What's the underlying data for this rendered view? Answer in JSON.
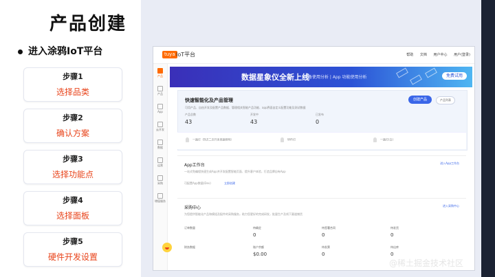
{
  "slide": {
    "title": "产品创建",
    "bullet": "进入涂鸦IoT平台",
    "steps": [
      {
        "label": "步骤1",
        "action": "选择品类"
      },
      {
        "label": "步骤2",
        "action": "确认方案"
      },
      {
        "label": "步骤3",
        "action": "选择功能点"
      },
      {
        "label": "步骤4",
        "action": "选择面板"
      },
      {
        "label": "步骤5",
        "action": "硬件开发设置"
      }
    ],
    "watermark": "@稀土掘金技术社区"
  },
  "colors": {
    "accent": "#e8431a",
    "brand": "#ff6a00",
    "primary": "#3a66e8"
  },
  "screenshot": {
    "logo": "tuya",
    "brand": "IoT平台",
    "top_nav": [
      "帮助",
      "文档",
      "用户中心",
      "用户(登录)"
    ],
    "sidebar": [
      {
        "label": "产品",
        "icon": "home-icon"
      },
      {
        "label": "产品",
        "icon": "product-icon"
      },
      {
        "label": "App",
        "icon": "app-icon"
      },
      {
        "label": "云开发",
        "icon": "cloud-icon"
      },
      {
        "label": "数据",
        "icon": "data-icon"
      },
      {
        "label": "运营",
        "icon": "ops-icon"
      },
      {
        "label": "采购",
        "icon": "purchase-icon"
      },
      {
        "label": "增值服务",
        "icon": "service-icon"
      }
    ],
    "banner": {
      "title": "数据星象仪全新上线",
      "subtitle": "设备使用分析 | App 功能使用分析",
      "button": "免费试用"
    },
    "quick": {
      "title": "快速智能化及产品管理",
      "desc": "可用产品、自由开发及配置产品数据、管理相关智能产品功能、app界面自定义配置功能及测试数据",
      "create_button": "创建产品",
      "secondary_button": "产品列表",
      "stats": [
        {
          "label": "产品总数",
          "value": "43"
        },
        {
          "label": "开发中",
          "value": "43"
        },
        {
          "label": "已发布",
          "value": "0"
        }
      ],
      "products": [
        "一路灯（BLE二次开发单路照明）",
        "WiFi灯",
        "一路灯(白)"
      ]
    },
    "app": {
      "title": "App工作台",
      "link": "进入App工作台",
      "desc": "一站式免编程快速生成App并开发配置智能页面、提升客户体验，打造品牌自有App",
      "foot": "可配置App数量(Dev)",
      "foot_link": "立即创建"
    },
    "purchase": {
      "title": "采购中心",
      "link": "进入采购中心",
      "desc": "为您提供智能化产品和模组及配件的采购服务，助力您更好的完成研发，批量生产及线下渠道铺货",
      "rows": [
        {
          "label": "订单数量",
          "cols": [
            {
              "label": "待确定",
              "value": "0"
            },
            {
              "label": "待签署合同",
              "value": "0"
            },
            {
              "label": "待发货",
              "value": "0"
            }
          ]
        },
        {
          "label": "财务数据",
          "cols": [
            {
              "label": "账户余额",
              "value": "$0.00"
            },
            {
              "label": "待发票",
              "value": "0"
            },
            {
              "label": "待出库",
              "value": "0"
            }
          ]
        }
      ]
    }
  }
}
